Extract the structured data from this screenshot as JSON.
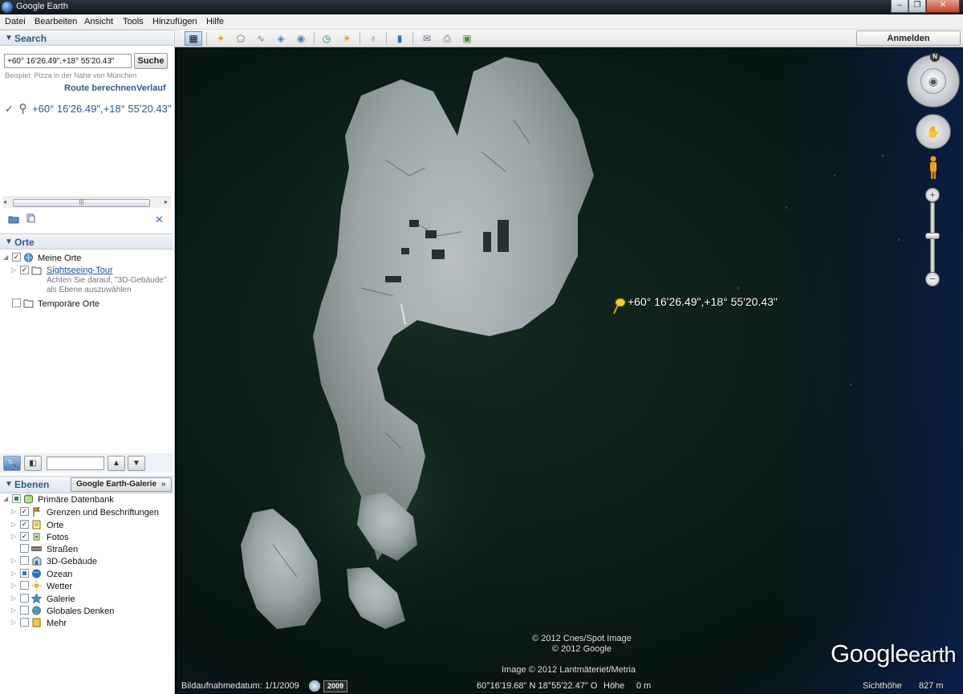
{
  "window": {
    "title": "Google Earth"
  },
  "menu": [
    "Datei",
    "Bearbeiten",
    "Ansicht",
    "Tools",
    "Hinzufügen",
    "Hilfe"
  ],
  "search": {
    "header": "Search",
    "value": "+60° 16'26.49\",+18° 55'20.43\"",
    "button": "Suche",
    "example": "Beispiel: Pizza in der Nähe von München",
    "route_link": "Route berechnen",
    "history_link": "Verlauf",
    "result": "+60° 16'26.49\",+18° 55'20.43\""
  },
  "places": {
    "header": "Orte",
    "items": [
      {
        "label": "Meine Orte"
      },
      {
        "label": "Sightseeing-Tour",
        "note1": "Achten Sie darauf, \"3D-Gebäude\"",
        "note2": "als Ebene auszuwählen"
      },
      {
        "label": "Temporäre Orte"
      }
    ]
  },
  "layers": {
    "header": "Ebenen",
    "gallery_button": "Google Earth-Galerie",
    "gallery_chevron": "»",
    "items": [
      {
        "label": "Primäre Datenbank",
        "checked": "partial"
      },
      {
        "label": "Grenzen und Beschriftungen",
        "checked": "yes",
        "icon": "borders-icon"
      },
      {
        "label": "Orte",
        "checked": "yes",
        "icon": "places-icon"
      },
      {
        "label": "Fotos",
        "checked": "yes",
        "icon": "photos-icon"
      },
      {
        "label": "Straßen",
        "checked": "no",
        "icon": "roads-icon"
      },
      {
        "label": "3D-Gebäude",
        "checked": "no",
        "icon": "buildings-3d-icon"
      },
      {
        "label": "Ozean",
        "checked": "partial",
        "icon": "ocean-icon"
      },
      {
        "label": "Wetter",
        "checked": "no",
        "icon": "weather-icon"
      },
      {
        "label": "Galerie",
        "checked": "no",
        "icon": "gallery-icon"
      },
      {
        "label": "Globales Denken",
        "checked": "no",
        "icon": "globe-icon"
      },
      {
        "label": "Mehr",
        "checked": "no",
        "icon": "more-icon"
      }
    ]
  },
  "toolbar": {
    "signin": "Anmelden"
  },
  "map": {
    "placemark_label": "+60° 16'26.49\",+18° 55'20.43\"",
    "credits_line1": "© 2012 Cnes/Spot Image",
    "credits_line2": "© 2012 Google",
    "image_credit": "Image © 2012 Lantmäteriet/Metria",
    "logo_word1": "Google",
    "logo_word2": "earth",
    "north": "N"
  },
  "status": {
    "imagery_date": "Bildaufnahmedatum: 1/1/2009",
    "year": "2009",
    "coords": "60°16'19.68\" N  18°55'22.47\" O",
    "elevation_label": "Höhe",
    "elevation_value": "0 m",
    "eye_alt_label": "Sichthöhe",
    "eye_alt_value": "827 m"
  },
  "colors": {
    "accent": "#2b5a8c",
    "water": "#0c1d17",
    "pin": "#f4d11a"
  }
}
